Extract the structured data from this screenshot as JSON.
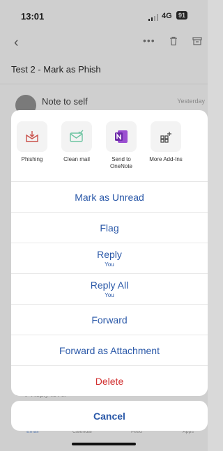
{
  "status": {
    "time": "13:01",
    "network": "4G",
    "battery": "91"
  },
  "message": {
    "subject": "Test 2 - Mark as Phish",
    "sender": "Note to self",
    "date": "Yesterday",
    "reply_hint": "Reply to All"
  },
  "addins": [
    {
      "label": "Phishing",
      "icon": "phishing-icon"
    },
    {
      "label": "Clean mail",
      "icon": "clean-mail-icon"
    },
    {
      "label": "Send to OneNote",
      "icon": "onenote-icon"
    },
    {
      "label": "More Add-Ins",
      "icon": "more-addins-icon"
    }
  ],
  "actions": [
    {
      "label": "Mark as Unread",
      "sub": ""
    },
    {
      "label": "Flag",
      "sub": ""
    },
    {
      "label": "Reply",
      "sub": "You"
    },
    {
      "label": "Reply All",
      "sub": "You"
    },
    {
      "label": "Forward",
      "sub": ""
    },
    {
      "label": "Forward as Attachment",
      "sub": ""
    },
    {
      "label": "Delete",
      "sub": ""
    }
  ],
  "cancel_label": "Cancel",
  "tabs": {
    "email": "Email",
    "calendar": "Calendar",
    "feed": "Feed",
    "apps": "Apps"
  },
  "colors": {
    "accent": "#2a58a8",
    "delete": "#d12f2f"
  }
}
